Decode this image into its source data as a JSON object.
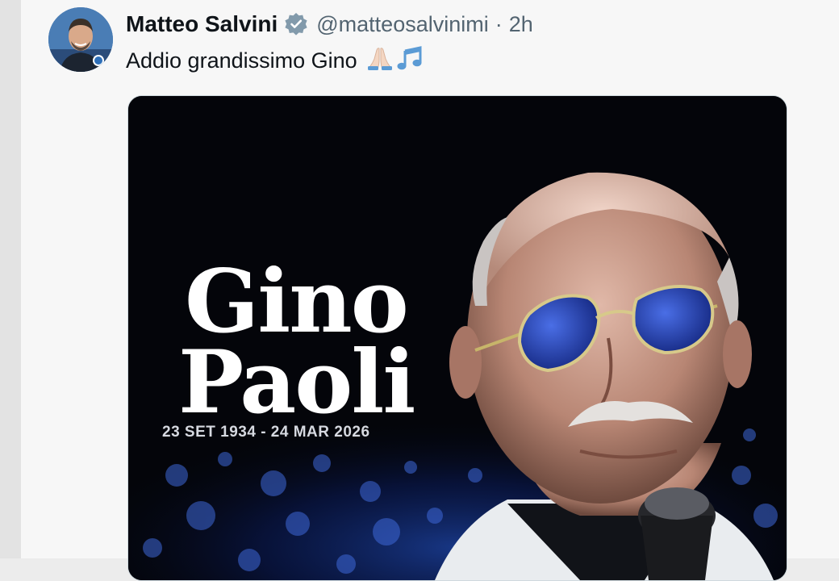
{
  "tweet": {
    "author_name": "Matteo Salvini",
    "handle": "@matteosalvinimi",
    "separator": "·",
    "time": "2h",
    "text": "Addio grandissimo Gino",
    "emojis": [
      "folded-hands-icon",
      "musical-notes-icon"
    ]
  },
  "media": {
    "title_line1": "Gino",
    "title_line2": "Paoli",
    "dates": "23 SET 1934 - 24 MAR 2026"
  },
  "colors": {
    "background": "#f7f7f7",
    "verified": "#829aab",
    "text": "#0f1419",
    "secondary": "#536471"
  }
}
